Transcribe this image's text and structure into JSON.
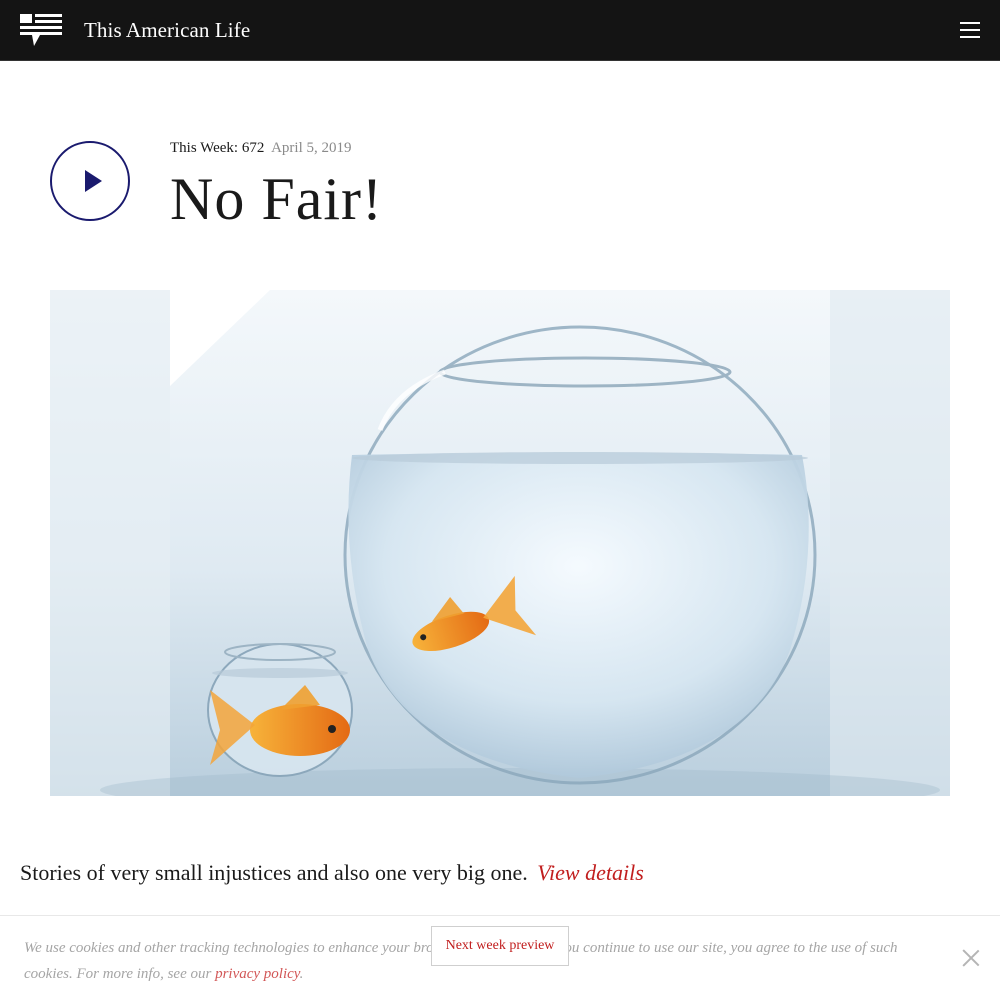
{
  "header": {
    "brand": "This American Life",
    "logo_icon": "tal-logo-icon",
    "menu_icon": "hamburger-menu-icon"
  },
  "episode": {
    "this_week_label": "This Week: 672",
    "date": "April 5, 2019",
    "title": "No Fair!",
    "play_icon": "play-icon"
  },
  "hero_image": {
    "description_icon": "goldfish-bowls-image"
  },
  "description": {
    "text": "Stories of very small injustices and also one very big one.",
    "link": "View details"
  },
  "cookie_banner": {
    "text_before": "We use cookies and other tracking technologies to enhance your browsing experience. If you continue to use our site, you agree to the use of such cookies. For more info, see our ",
    "link": "privacy policy",
    "text_after": ".",
    "close_icon": "close-icon"
  },
  "next_week_button": "Next week preview",
  "colors": {
    "header_bg": "#141414",
    "accent_red": "#c11e1e",
    "play_ring": "#1a1a6e"
  }
}
